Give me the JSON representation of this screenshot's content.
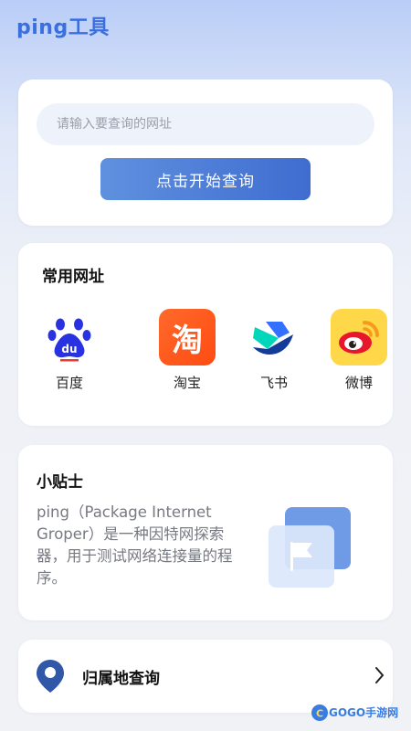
{
  "app": {
    "title": "ping工具"
  },
  "search": {
    "placeholder": "请输入要查询的网址",
    "value": "",
    "button_label": "点击开始查询"
  },
  "common_sites": {
    "title": "常用网址",
    "items": [
      {
        "label": "百度",
        "icon": "baidu-paw-icon",
        "color": "#2932e1"
      },
      {
        "label": "淘宝",
        "icon": "taobao-icon",
        "glyph": "淘",
        "color": "#ff5000"
      },
      {
        "label": "飞书",
        "icon": "feishu-bird-icon",
        "color": "#3370ff"
      },
      {
        "label": "微博",
        "icon": "weibo-eye-icon",
        "color": "#e6162d"
      }
    ]
  },
  "tips": {
    "title": "小贴士",
    "text": "ping（Package Internet Groper）是一种因特网探索器，用于测试网络连接量的程序。",
    "illustration": "flag-card-icon"
  },
  "location_query": {
    "label": "归属地查询",
    "icon": "location-pin-icon",
    "chevron": "chevron-right-icon"
  },
  "watermark": {
    "logo": "GOGO手游网",
    "glyph": "C"
  },
  "colors": {
    "accent": "#3b6fe0",
    "button_start": "#5f91df",
    "button_end": "#3f6cd0"
  }
}
